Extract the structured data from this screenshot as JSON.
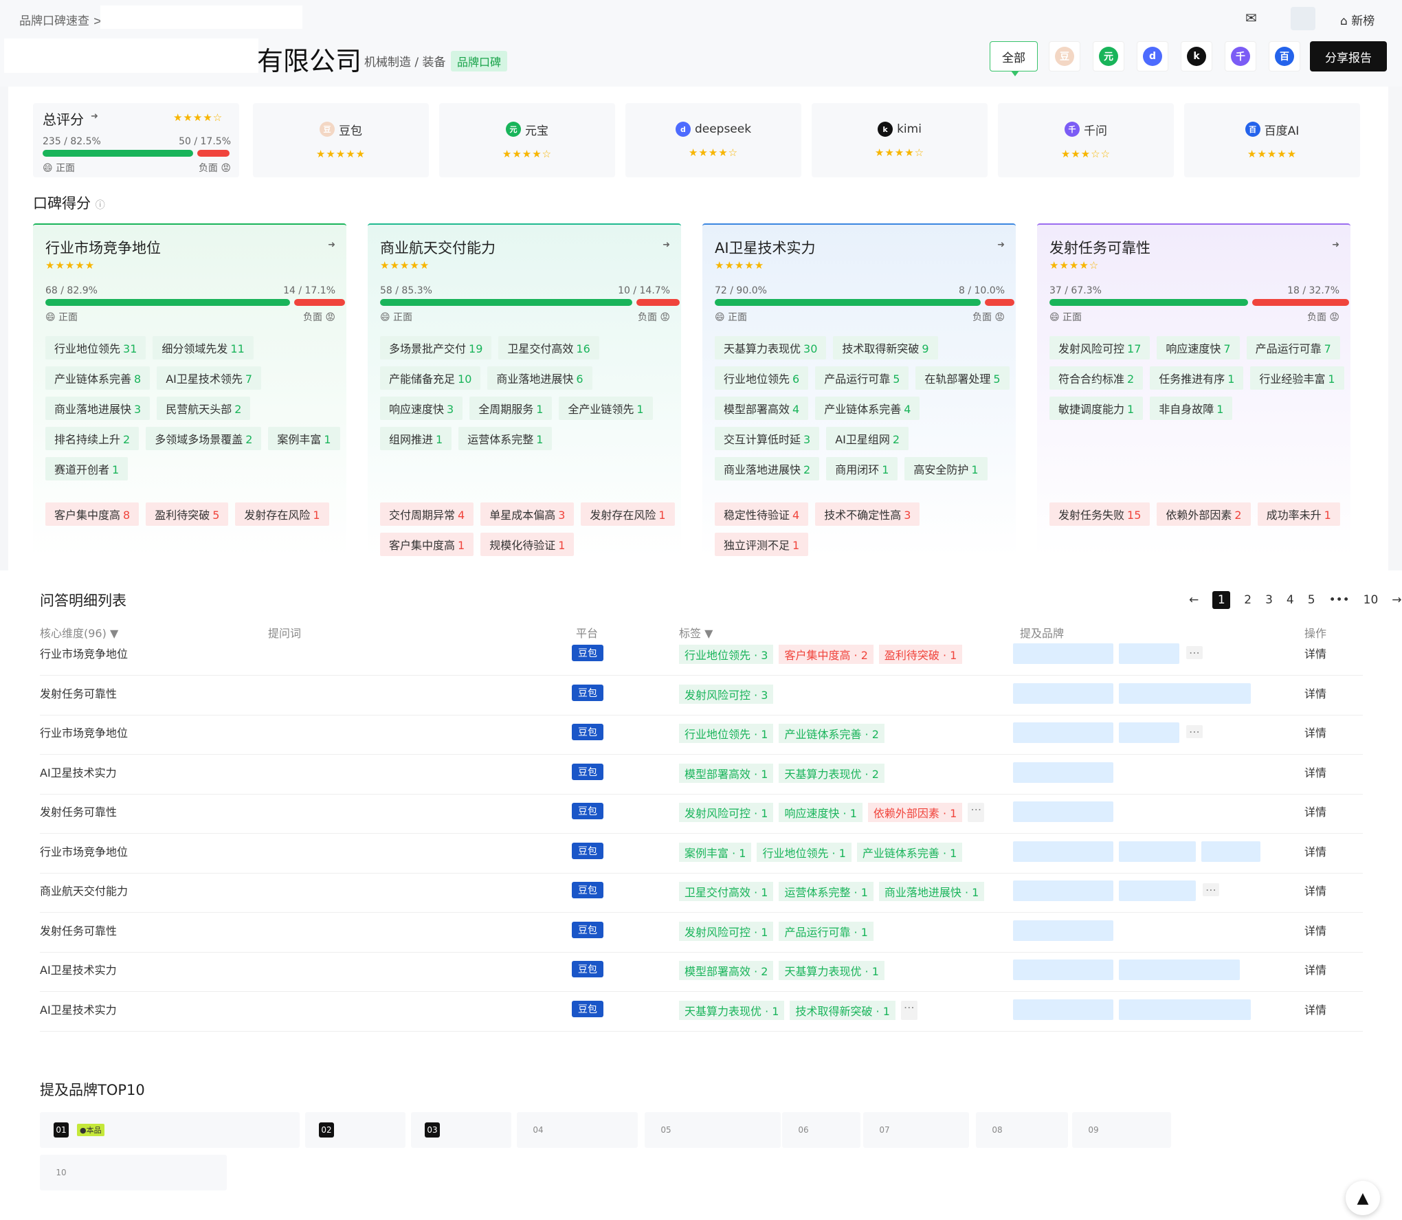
{
  "breadcrumb": {
    "root": "品牌口碑速查",
    "sep": ">"
  },
  "topbar": {
    "new_label": "新榜"
  },
  "company": {
    "title": "有限公司",
    "industry": "机械制造 / 装备",
    "tag": "品牌口碑"
  },
  "platform_filter": {
    "all_label": "全部",
    "share_label": "分享报告"
  },
  "overall": {
    "title": "总评分",
    "stars": "★★★★☆",
    "pos_count": "235",
    "pos_pct": "82.5%",
    "neg_count": "50",
    "neg_pct": "17.5%",
    "pos_label": "正面",
    "neg_label": "负面",
    "pos_ratio": 0.825
  },
  "platforms": [
    {
      "name": "豆包",
      "stars": "★★★★★",
      "color": "#f3d7c4",
      "icon": "doubao-icon"
    },
    {
      "name": "元宝",
      "stars": "★★★★☆",
      "color": "#19b45a",
      "icon": "yuanbao-icon"
    },
    {
      "name": "deepseek",
      "stars": "★★★★☆",
      "color": "#4d6bfe",
      "icon": "deepseek-icon"
    },
    {
      "name": "kimi",
      "stars": "★★★★☆",
      "color": "#111111",
      "icon": "kimi-icon"
    },
    {
      "name": "千问",
      "stars": "★★★☆☆",
      "color": "#7b5cf5",
      "icon": "qianwen-icon"
    },
    {
      "name": "百度AI",
      "stars": "★★★★★",
      "color": "#2463eb",
      "icon": "baidu-ai-icon"
    }
  ],
  "reputation": {
    "title": "口碑得分",
    "pos_label": "正面",
    "neg_label": "负面"
  },
  "dimensions": [
    {
      "title": "行业市场竞争地位",
      "stars": "★★★★★",
      "pos": "68 / 82.9%",
      "neg": "14 / 17.1%",
      "pos_ratio": 0.829,
      "pos_tags": [
        [
          "行业地位领先",
          "31"
        ],
        [
          "细分领域先发",
          "11"
        ],
        [
          "产业链体系完善",
          "8"
        ],
        [
          "AI卫星技术领先",
          "7"
        ],
        [
          "商业落地进展快",
          "3"
        ],
        [
          "民营航天头部",
          "2"
        ],
        [
          "排名持续上升",
          "2"
        ],
        [
          "多领域多场景覆盖",
          "2"
        ],
        [
          "案例丰富",
          "1"
        ],
        [
          "赛道开创者",
          "1"
        ]
      ],
      "neg_tags": [
        [
          "客户集中度高",
          "8"
        ],
        [
          "盈利待突破",
          "5"
        ],
        [
          "发射存在风险",
          "1"
        ]
      ]
    },
    {
      "title": "商业航天交付能力",
      "stars": "★★★★★",
      "pos": "58 / 85.3%",
      "neg": "10 / 14.7%",
      "pos_ratio": 0.853,
      "pos_tags": [
        [
          "多场景批产交付",
          "19"
        ],
        [
          "卫星交付高效",
          "16"
        ],
        [
          "产能储备充足",
          "10"
        ],
        [
          "商业落地进展快",
          "6"
        ],
        [
          "响应速度快",
          "3"
        ],
        [
          "全周期服务",
          "1"
        ],
        [
          "全产业链领先",
          "1"
        ],
        [
          "组网推进",
          "1"
        ],
        [
          "运营体系完整",
          "1"
        ]
      ],
      "neg_tags": [
        [
          "交付周期异常",
          "4"
        ],
        [
          "单星成本偏高",
          "3"
        ],
        [
          "发射存在风险",
          "1"
        ],
        [
          "客户集中度高",
          "1"
        ],
        [
          "规模化待验证",
          "1"
        ]
      ]
    },
    {
      "title": "AI卫星技术实力",
      "stars": "★★★★★",
      "pos": "72 / 90.0%",
      "neg": "8 / 10.0%",
      "pos_ratio": 0.9,
      "pos_tags": [
        [
          "天基算力表现优",
          "30"
        ],
        [
          "技术取得新突破",
          "9"
        ],
        [
          "行业地位领先",
          "6"
        ],
        [
          "产品运行可靠",
          "5"
        ],
        [
          "在轨部署处理",
          "5"
        ],
        [
          "模型部署高效",
          "4"
        ],
        [
          "产业链体系完善",
          "4"
        ],
        [
          "交互计算低时延",
          "3"
        ],
        [
          "AI卫星组网",
          "2"
        ],
        [
          "商业落地进展快",
          "2"
        ],
        [
          "商用闭环",
          "1"
        ],
        [
          "高安全防护",
          "1"
        ]
      ],
      "neg_tags": [
        [
          "稳定性待验证",
          "4"
        ],
        [
          "技术不确定性高",
          "3"
        ],
        [
          "独立评测不足",
          "1"
        ]
      ]
    },
    {
      "title": "发射任务可靠性",
      "stars": "★★★★☆",
      "pos": "37 / 67.3%",
      "neg": "18 / 32.7%",
      "pos_ratio": 0.673,
      "pos_tags": [
        [
          "发射风险可控",
          "17"
        ],
        [
          "响应速度快",
          "7"
        ],
        [
          "产品运行可靠",
          "7"
        ],
        [
          "符合合约标准",
          "2"
        ],
        [
          "任务推进有序",
          "1"
        ],
        [
          "行业经验丰富",
          "1"
        ],
        [
          "敏捷调度能力",
          "1"
        ],
        [
          "非自身故障",
          "1"
        ]
      ],
      "neg_tags": [
        [
          "发射任务失败",
          "15"
        ],
        [
          "依赖外部因素",
          "2"
        ],
        [
          "成功率未升",
          "1"
        ]
      ]
    }
  ],
  "qa": {
    "title": "问答明细列表",
    "headers": {
      "dim": "核心维度(96)",
      "query": "提问词",
      "platform": "平台",
      "tags": "标签",
      "brands": "提及品牌",
      "op": "操作"
    },
    "pages": [
      "1",
      "2",
      "3",
      "4",
      "5",
      "•••",
      "10"
    ],
    "rows": [
      {
        "dim": "行业市场竞争地位",
        "platform": "豆包",
        "tags": [
          [
            "p",
            "行业地位领先 · 3"
          ],
          [
            "n",
            "客户集中度高 · 2"
          ],
          [
            "n",
            "盈利待突破 · 1"
          ]
        ],
        "op": "详情"
      },
      {
        "dim": "发射任务可靠性",
        "platform": "豆包",
        "tags": [
          [
            "p",
            "发射风险可控 · 3"
          ]
        ],
        "op": "详情"
      },
      {
        "dim": "行业市场竞争地位",
        "platform": "豆包",
        "tags": [
          [
            "p",
            "行业地位领先 · 1"
          ],
          [
            "p",
            "产业链体系完善 · 2"
          ]
        ],
        "op": "详情"
      },
      {
        "dim": "AI卫星技术实力",
        "platform": "豆包",
        "tags": [
          [
            "p",
            "模型部署高效 · 1"
          ],
          [
            "p",
            "天基算力表现优 · 2"
          ]
        ],
        "op": "详情"
      },
      {
        "dim": "发射任务可靠性",
        "platform": "豆包",
        "tags": [
          [
            "p",
            "发射风险可控 · 1"
          ],
          [
            "p",
            "响应速度快 · 1"
          ],
          [
            "n",
            "依赖外部因素 · 1"
          ]
        ],
        "op": "详情"
      },
      {
        "dim": "行业市场竞争地位",
        "platform": "豆包",
        "tags": [
          [
            "p",
            "案例丰富 · 1"
          ],
          [
            "p",
            "行业地位领先 · 1"
          ],
          [
            "p",
            "产业链体系完善 · 1"
          ]
        ],
        "op": "详情"
      },
      {
        "dim": "商业航天交付能力",
        "platform": "豆包",
        "tags": [
          [
            "p",
            "卫星交付高效 · 1"
          ],
          [
            "p",
            "运营体系完整 · 1"
          ],
          [
            "p",
            "商业落地进展快 · 1"
          ]
        ],
        "op": "详情"
      },
      {
        "dim": "发射任务可靠性",
        "platform": "豆包",
        "tags": [
          [
            "p",
            "发射风险可控 · 1"
          ],
          [
            "p",
            "产品运行可靠 · 1"
          ]
        ],
        "op": "详情"
      },
      {
        "dim": "AI卫星技术实力",
        "platform": "豆包",
        "tags": [
          [
            "p",
            "模型部署高效 · 2"
          ],
          [
            "p",
            "天基算力表现优 · 1"
          ]
        ],
        "op": "详情"
      },
      {
        "dim": "AI卫星技术实力",
        "platform": "豆包",
        "tags": [
          [
            "p",
            "天基算力表现优 · 1"
          ],
          [
            "p",
            "技术取得新突破 · 1"
          ]
        ],
        "op": "详情"
      }
    ]
  },
  "top10": {
    "title": "提及品牌TOP10",
    "self_label": "本品",
    "ranks": [
      "01",
      "02",
      "03",
      "04",
      "05",
      "06",
      "07",
      "08",
      "09",
      "10"
    ]
  }
}
